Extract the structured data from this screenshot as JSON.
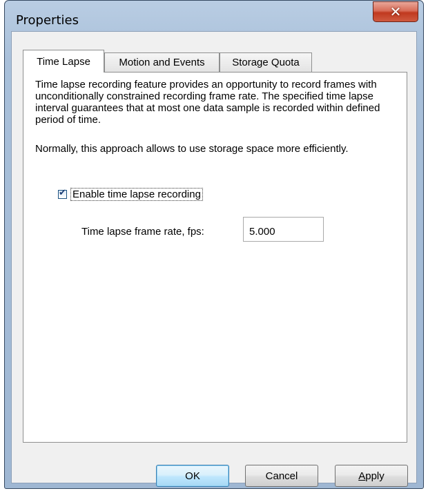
{
  "window": {
    "title": "Properties",
    "close_glyph": "✕"
  },
  "tabs": [
    {
      "label": "Time Lapse",
      "active": true
    },
    {
      "label": "Motion and Events",
      "active": false
    },
    {
      "label": "Storage Quota",
      "active": false
    }
  ],
  "panel": {
    "description": "Time lapse recording feature provides an opportunity to record frames with unconditionally constrained recording frame rate. The specified time lapse interval guarantees that at most one data sample is recorded within defined period of time.",
    "note": "Normally, this approach allows to use storage space more efficiently.",
    "enable_checkbox": {
      "label": "Enable time lapse recording",
      "checked": true
    },
    "frame_rate": {
      "label": "Time lapse frame rate, fps:",
      "value": "5.000"
    }
  },
  "buttons": {
    "ok": "OK",
    "cancel": "Cancel",
    "apply_mnemonic": "A",
    "apply_rest": "pply"
  },
  "icons": {
    "close": "close-icon",
    "check": "checkmark-icon"
  },
  "colors": {
    "accent": "#3c7fb1",
    "close": "#c0391f",
    "frame": "#9fb7d3"
  }
}
